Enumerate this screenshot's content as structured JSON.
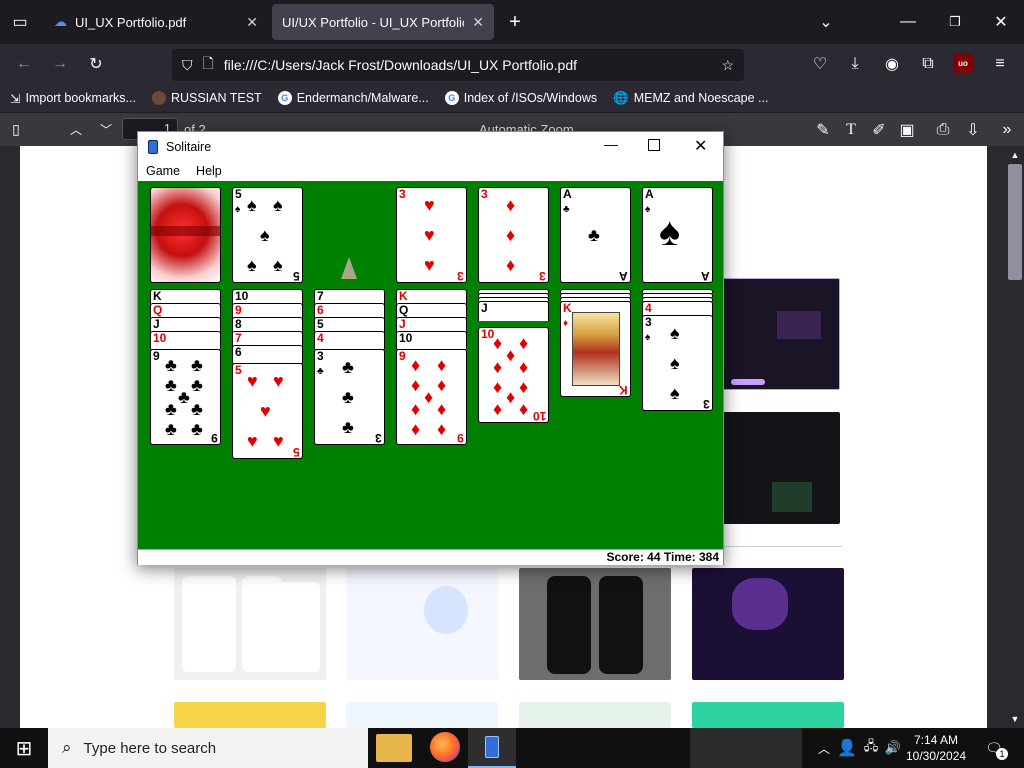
{
  "browser": {
    "tabs": [
      {
        "title": "UI_UX Portfolio.pdf",
        "active": false
      },
      {
        "title": "UI/UX Portfolio - UI_UX Portfolio.pdf",
        "active": true
      }
    ],
    "url": "file:///C:/Users/Jack Frost/Downloads/UI_UX Portfolio.pdf",
    "bookmarks": [
      {
        "label": "Import bookmarks...",
        "icon": "import-icon"
      },
      {
        "label": "RUSSIAN TEST",
        "icon": "avatar-icon"
      },
      {
        "label": "Endermanch/Malware...",
        "icon": "github-icon"
      },
      {
        "label": "Index of /ISOs/Windows",
        "icon": "google-icon"
      },
      {
        "label": "MEMZ and Noescape ...",
        "icon": "globe-icon"
      }
    ]
  },
  "pdf_toolbar": {
    "page_number": "1",
    "page_total": "of 2",
    "zoom": "Automatic Zoom"
  },
  "solitaire": {
    "title": "Solitaire",
    "menu": [
      "Game",
      "Help"
    ],
    "status": "Score: 44 Time: 384",
    "colors": {
      "felt": "#008000",
      "red": "#e00000"
    },
    "waste_card": {
      "rank": "5",
      "suit": "♠"
    },
    "foundations": [
      {
        "rank": "3",
        "suit": "♥"
      },
      {
        "rank": "3",
        "suit": "♦"
      },
      {
        "rank": "A",
        "suit": "♣"
      },
      {
        "rank": "A",
        "suit": "♠"
      }
    ],
    "tableau": [
      {
        "stubs": [
          {
            "r": "K",
            "s": "♠"
          },
          {
            "r": "Q",
            "s": "♥"
          },
          {
            "r": "J",
            "s": "♣"
          },
          {
            "r": "10",
            "s": "♥"
          }
        ],
        "top": {
          "rank": "9",
          "suit": "♣"
        }
      },
      {
        "stubs": [
          {
            "r": "10",
            "s": "♠"
          },
          {
            "r": "9",
            "s": "♥"
          },
          {
            "r": "8",
            "s": "♣"
          },
          {
            "r": "7",
            "s": "♥"
          },
          {
            "r": "6",
            "s": "♠"
          }
        ],
        "top": {
          "rank": "5",
          "suit": "♥"
        }
      },
      {
        "stubs": [
          {
            "r": "7",
            "s": "♠"
          },
          {
            "r": "6",
            "s": "♥"
          },
          {
            "r": "5",
            "s": "♠"
          },
          {
            "r": "4",
            "s": "♥"
          }
        ],
        "top": {
          "rank": "3",
          "suit": "♣"
        }
      },
      {
        "stubs": [
          {
            "r": "K",
            "s": "♥"
          },
          {
            "r": "Q",
            "s": "♠"
          },
          {
            "r": "J",
            "s": "♥"
          },
          {
            "r": "10",
            "s": "♠"
          }
        ],
        "top": {
          "rank": "9",
          "suit": "♦"
        }
      },
      {
        "stubs": [
          {
            "r": "J",
            "s": "♠"
          }
        ],
        "top": {
          "rank": "10",
          "suit": "♦"
        }
      },
      {
        "stubs": [],
        "top": {
          "rank": "K",
          "suit": "♦"
        }
      },
      {
        "stubs": [
          {
            "r": "4",
            "s": "♥"
          }
        ],
        "top": {
          "rank": "3",
          "suit": "♠"
        }
      }
    ]
  },
  "taskbar": {
    "search_placeholder": "Type here to search",
    "time": "7:14 AM",
    "date": "10/30/2024",
    "notification_count": "1"
  }
}
